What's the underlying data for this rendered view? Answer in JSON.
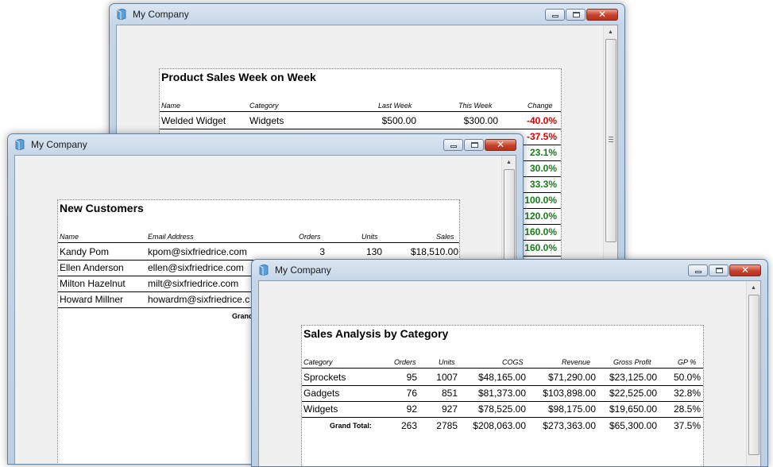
{
  "windows": {
    "product_sales": {
      "title": "My Company",
      "report": {
        "title": "Product Sales Week on Week",
        "columns": [
          "Name",
          "Category",
          "Last Week",
          "This Week",
          "Change"
        ],
        "rows": [
          {
            "name": "Welded Widget",
            "category": "Widgets",
            "last_week": "$500.00",
            "this_week": "$300.00",
            "change": "-40.0%"
          },
          {
            "change": "-37.5%"
          },
          {
            "change": "23.1%"
          },
          {
            "change": "30.0%"
          },
          {
            "change": "33.3%"
          },
          {
            "change": "100.0%"
          },
          {
            "change": "120.0%"
          },
          {
            "change": "160.0%"
          },
          {
            "change": "160.0%"
          }
        ]
      }
    },
    "new_customers": {
      "title": "My Company",
      "report": {
        "title": "New Customers",
        "columns": [
          "Name",
          "Email Address",
          "Orders",
          "Units",
          "Sales"
        ],
        "rows": [
          {
            "name": "Kandy Pom",
            "email": "kpom@sixfriedrice.com",
            "orders": "3",
            "units": "130",
            "sales": "$18,510.00"
          },
          {
            "name": "Ellen Anderson",
            "email": "ellen@sixfriedrice.com"
          },
          {
            "name": "Milton Hazelnut",
            "email": "milt@sixfriedrice.com"
          },
          {
            "name": "Howard Millner",
            "email": "howardm@sixfriedrice.c"
          }
        ],
        "grand_total_label": "Grand"
      }
    },
    "sales_analysis": {
      "title": "My Company",
      "report": {
        "title": "Sales Analysis by Category",
        "columns": [
          "Category",
          "Orders",
          "Units",
          "COGS",
          "Revenue",
          "Gross Profit",
          "GP %"
        ],
        "rows": [
          {
            "category": "Sprockets",
            "orders": "95",
            "units": "1007",
            "cogs": "$48,165.00",
            "revenue": "$71,290.00",
            "gross_profit": "$23,125.00",
            "gp": "50.0%"
          },
          {
            "category": "Gadgets",
            "orders": "76",
            "units": "851",
            "cogs": "$81,373.00",
            "revenue": "$103,898.00",
            "gross_profit": "$22,525.00",
            "gp": "32.8%"
          },
          {
            "category": "Widgets",
            "orders": "92",
            "units": "927",
            "cogs": "$78,525.00",
            "revenue": "$98,175.00",
            "gross_profit": "$19,650.00",
            "gp": "28.5%"
          }
        ],
        "grand_total": {
          "label": "Grand Total:",
          "orders": "263",
          "units": "2785",
          "cogs": "$208,063.00",
          "revenue": "$273,363.00",
          "gross_profit": "$65,300.00",
          "gp": "37.5%"
        }
      }
    }
  },
  "controls": {
    "minimize_icon": "minimize-icon",
    "maximize_icon": "maximize-icon",
    "close_icon": "close-icon",
    "close_glyph": "✕"
  },
  "colors": {
    "negative": "#d40000",
    "positive": "#1a7a1a"
  }
}
